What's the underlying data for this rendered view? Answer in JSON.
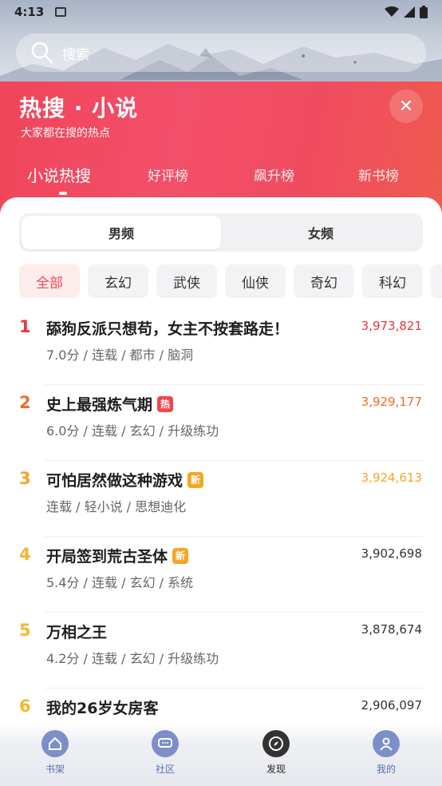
{
  "status": {
    "time": "4:13"
  },
  "search": {
    "placeholder": "搜索"
  },
  "header": {
    "title": "热搜 · 小说",
    "subtitle": "大家都在搜的热点",
    "close_label": "✕",
    "tabs": [
      {
        "label": "小说热搜",
        "active": true
      },
      {
        "label": "好评榜",
        "active": false
      },
      {
        "label": "飙升榜",
        "active": false
      },
      {
        "label": "新书榜",
        "active": false
      }
    ]
  },
  "gender": [
    {
      "label": "男频",
      "active": true
    },
    {
      "label": "女频",
      "active": false
    }
  ],
  "categories": [
    {
      "label": "全部",
      "active": true
    },
    {
      "label": "玄幻",
      "active": false
    },
    {
      "label": "武侠",
      "active": false
    },
    {
      "label": "仙侠",
      "active": false
    },
    {
      "label": "奇幻",
      "active": false
    },
    {
      "label": "科幻",
      "active": false
    },
    {
      "label": "",
      "active": false
    }
  ],
  "ranking": [
    {
      "rank": "1",
      "title": "舔狗反派只想苟，女主不按套路走！",
      "badge": "",
      "meta": "7.0分 / 连载 / 都市 / 脑洞",
      "count": "3,973,821",
      "color": "#e8343c"
    },
    {
      "rank": "2",
      "title": "史上最强炼气期",
      "badge": "热",
      "badge_color": "#f2454e",
      "meta": "6.0分 / 连载 / 玄幻 / 升级练功",
      "count": "3,929,177",
      "color": "#f06a27"
    },
    {
      "rank": "3",
      "title": "可怕居然做这种游戏",
      "badge": "新",
      "badge_color": "#f5a623",
      "meta": "连载 / 轻小说 / 思想迪化",
      "count": "3,924,613",
      "color": "#f5a623"
    },
    {
      "rank": "4",
      "title": "开局签到荒古圣体",
      "badge": "新",
      "badge_color": "#f5a623",
      "meta": "5.4分 / 连载 / 玄幻 / 系统",
      "count": "3,902,698",
      "color": "#f5b731"
    },
    {
      "rank": "5",
      "title": "万相之王",
      "badge": "",
      "meta": "4.2分 / 连载 / 玄幻 / 升级练功",
      "count": "3,878,674",
      "color": "#f5b731"
    },
    {
      "rank": "6",
      "title": "我的26岁女房客",
      "badge": "",
      "meta": "",
      "count": "2,906,097",
      "color": "#f5b731"
    }
  ],
  "nav": [
    {
      "label": "书架",
      "icon": "bookshelf-home-icon",
      "active": false
    },
    {
      "label": "社区",
      "icon": "community-chat-icon",
      "active": false
    },
    {
      "label": "发现",
      "icon": "discover-compass-icon",
      "active": true
    },
    {
      "label": "我的",
      "icon": "profile-user-icon",
      "active": false
    }
  ]
}
